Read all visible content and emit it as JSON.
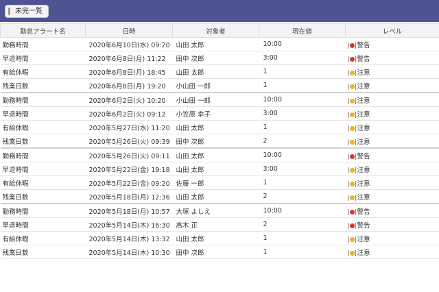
{
  "filter_button": {
    "label": "未完一覧"
  },
  "colors": {
    "topbar": "#4e5492",
    "warning": "#d9352d",
    "caution": "#f0b124"
  },
  "table": {
    "headers": [
      "勤怠アラート名",
      "日時",
      "対象者",
      "現在値",
      "レベル"
    ],
    "rows": [
      {
        "name": "勤務時間",
        "datetime": "2020年6月10日(水) 09:20",
        "target": "山田 太郎",
        "value": "10:00",
        "level": "警告",
        "level_type": "warning"
      },
      {
        "name": "早退時間",
        "datetime": "2020年6月8日(月) 11:22",
        "target": "田中 次郎",
        "value": "3:00",
        "level": "警告",
        "level_type": "warning"
      },
      {
        "name": "有給休暇",
        "datetime": "2020年6月8日(月) 18:45",
        "target": "山田 太郎",
        "value": "1",
        "level": "注意",
        "level_type": "caution"
      },
      {
        "name": "残業日数",
        "datetime": "2020年6月8日(月) 19:20",
        "target": "小山田 一郎",
        "value": "1",
        "level": "注意",
        "level_type": "caution"
      },
      {
        "name": "勤務時間",
        "datetime": "2020年6月2日(火) 10:20",
        "target": "小山田 一郎",
        "value": "10:00",
        "level": "注意",
        "level_type": "caution"
      },
      {
        "name": "早退時間",
        "datetime": "2020年6月2日(火) 09:12",
        "target": "小笠原 幸子",
        "value": "3:00",
        "level": "注意",
        "level_type": "caution"
      },
      {
        "name": "有給休暇",
        "datetime": "2020年5月27日(水) 11:20",
        "target": "山田 太郎",
        "value": "1",
        "level": "注意",
        "level_type": "caution"
      },
      {
        "name": "残業日数",
        "datetime": "2020年5月26日(火) 09:39",
        "target": "田中 次郎",
        "value": "2",
        "level": "注意",
        "level_type": "caution"
      },
      {
        "name": "勤務時間",
        "datetime": "2020年5月26日(火) 09:11",
        "target": "山田 太郎",
        "value": "10:00",
        "level": "警告",
        "level_type": "warning"
      },
      {
        "name": "早退時間",
        "datetime": "2020年5月22日(金) 19:18",
        "target": "山田 太郎",
        "value": "3:00",
        "level": "注意",
        "level_type": "caution"
      },
      {
        "name": "有給休暇",
        "datetime": "2020年5月22日(金) 09:20",
        "target": "佐藤 一郎",
        "value": "1",
        "level": "注意",
        "level_type": "caution"
      },
      {
        "name": "残業日数",
        "datetime": "2020年5月18日(月) 12:36",
        "target": "山田 太郎",
        "value": "2",
        "level": "注意",
        "level_type": "caution"
      },
      {
        "name": "勤務時間",
        "datetime": "2020年5月18日(月) 10:57",
        "target": "大塚 よしえ",
        "value": "10:00",
        "level": "警告",
        "level_type": "warning"
      },
      {
        "name": "早退時間",
        "datetime": "2020年5月14日(木) 16:30",
        "target": "高木 正",
        "value": "2",
        "level": "警告",
        "level_type": "warning"
      },
      {
        "name": "有給休暇",
        "datetime": "2020年5月14日(木) 13:32",
        "target": "山田 太郎",
        "value": "1",
        "level": "注意",
        "level_type": "caution"
      },
      {
        "name": "残業日数",
        "datetime": "2020年5月14日(木) 10:30",
        "target": "田中 次郎",
        "value": "1",
        "level": "注意",
        "level_type": "caution"
      }
    ]
  }
}
